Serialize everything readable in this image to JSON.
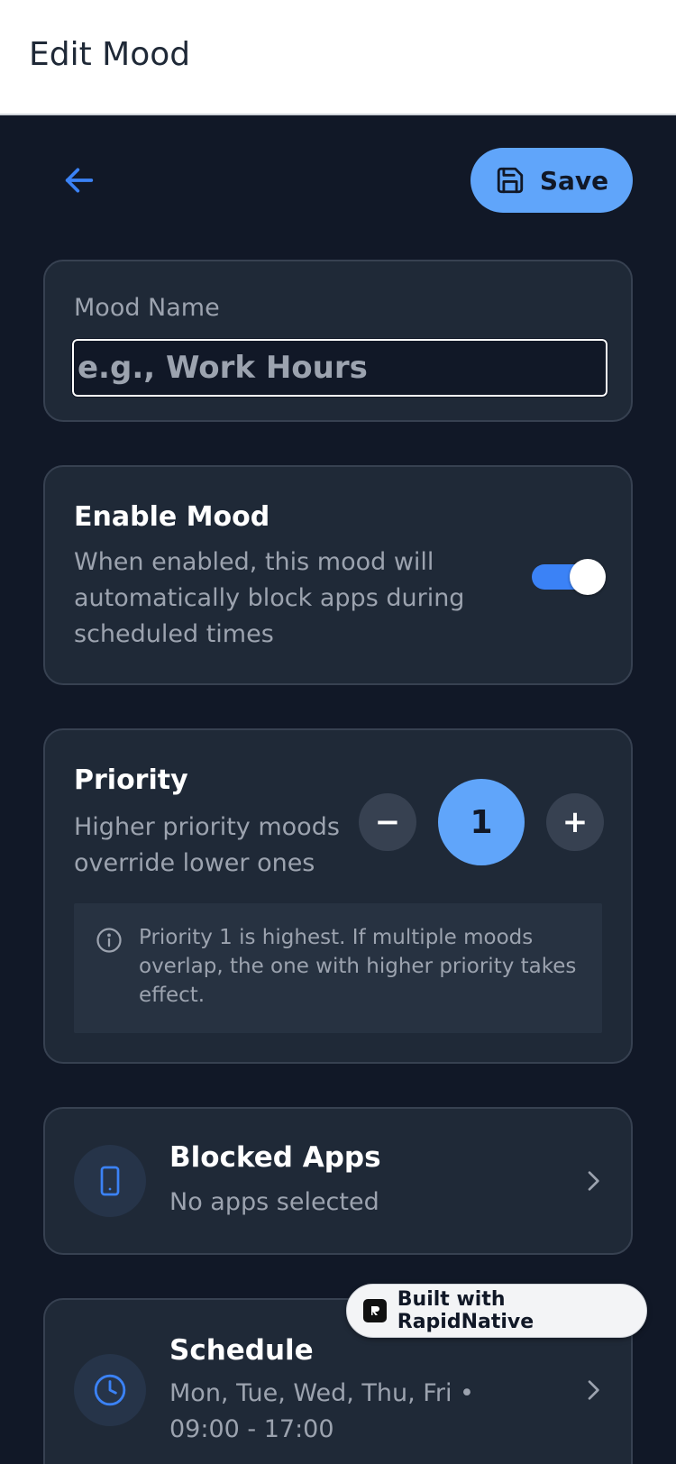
{
  "header": {
    "title": "Edit Mood"
  },
  "toolbar": {
    "save_label": "Save"
  },
  "mood_name": {
    "label": "Mood Name",
    "value": "",
    "placeholder": "e.g., Work Hours"
  },
  "enable": {
    "title": "Enable Mood",
    "description": "When enabled, this mood will automatically block apps during scheduled times",
    "enabled": true
  },
  "priority": {
    "title": "Priority",
    "description": "Higher priority moods override lower ones",
    "minus_label": "−",
    "value": "1",
    "plus_label": "+",
    "info": "Priority 1 is highest. If multiple moods overlap, the one with higher priority takes effect."
  },
  "blocked_apps": {
    "title": "Blocked Apps",
    "subtitle": "No apps selected",
    "icon": "phone-icon"
  },
  "schedule": {
    "title": "Schedule",
    "subtitle": "Mon, Tue, Wed, Thu, Fri • 09:00 - 17:00",
    "icon": "clock-icon"
  },
  "badge": {
    "label": "Built with RapidNative"
  },
  "colors": {
    "background": "#111827",
    "card": "#1f2937",
    "accent": "#60a5fa",
    "toggle_on": "#3b82f6"
  }
}
